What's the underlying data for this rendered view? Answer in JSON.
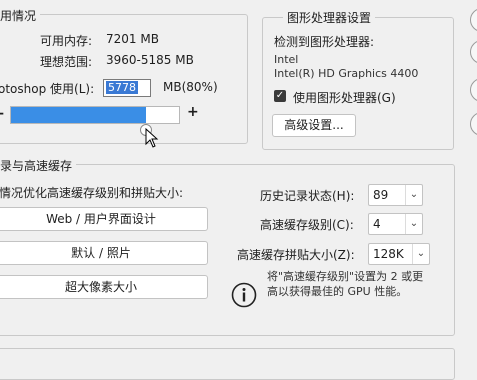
{
  "memory": {
    "title": "用情况",
    "available_label": "可用内存:",
    "available_value": "7201 MB",
    "ideal_label": "理想范围:",
    "ideal_value": "3960-5185 MB",
    "use_label": "otoshop 使用(L):",
    "use_value": "5778",
    "use_unit": "MB(80%)",
    "minus": "-",
    "plus": "+",
    "slider_fraction": 0.8
  },
  "gpu": {
    "title": "图形处理器设置",
    "detected_label": "检测到图形处理器:",
    "vendor": "Intel",
    "model": "Intel(R) HD Graphics 4400",
    "use_gpu_label": "使用图形处理器(G)",
    "use_gpu_checked": true,
    "advanced_button": "高级设置..."
  },
  "cache": {
    "title": "录与高速缓存",
    "intro": "情况优化高速缓存级别和拼贴大小:",
    "preset_buttons": [
      "Web / 用户界面设计",
      "默认 / 照片",
      "超大像素大小"
    ],
    "history_label": "历史记录状态(H):",
    "history_value": "89",
    "levels_label": "高速缓存级别(C):",
    "levels_value": "4",
    "tile_label": "高速缓存拼贴大小(Z):",
    "tile_value": "128K",
    "info_line1": "将\"高速缓存级别\"设置为 2 或更",
    "info_line2": "高以获得最佳的 GPU 性能。"
  }
}
